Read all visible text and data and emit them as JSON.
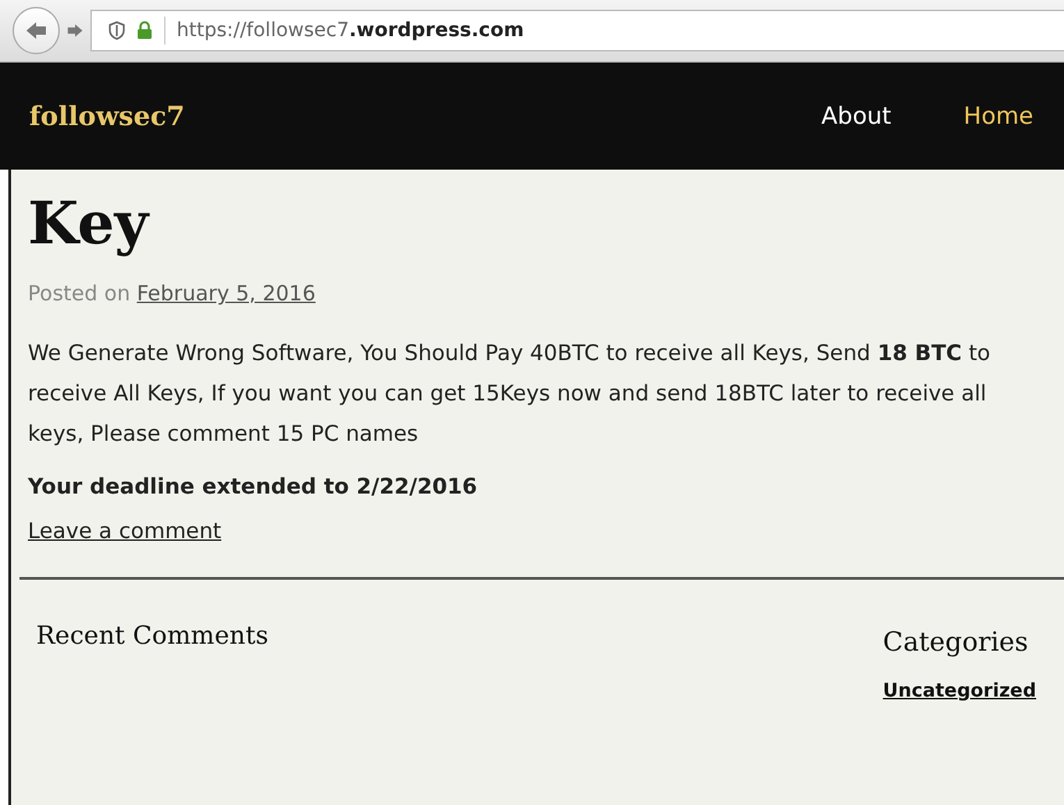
{
  "browser": {
    "url": "https://followsec7**.wordpress.com**"
  },
  "site": {
    "title": "followsec7",
    "nav": [
      {
        "label": "About",
        "selected": false
      },
      {
        "label": "Home",
        "selected": true
      }
    ]
  },
  "post": {
    "title": "Key",
    "posted_prefix": "Posted on",
    "date": "February 5, 2016",
    "body": "We Generate Wrong Software, You Should Pay 40BTC to receive all Keys, Send **18 BTC** to receive All Keys, If you want you can get 15Keys now and send 18BTC later to receive all keys, Please comment 15 PC names",
    "deadline": "Your deadline extended to 2/22/2016",
    "comment_link": "Leave a comment"
  },
  "widgets": {
    "recent_comments": {
      "title": "Recent Comments"
    },
    "categories": {
      "title": "Categories",
      "items": [
        "Uncategorized"
      ]
    }
  }
}
